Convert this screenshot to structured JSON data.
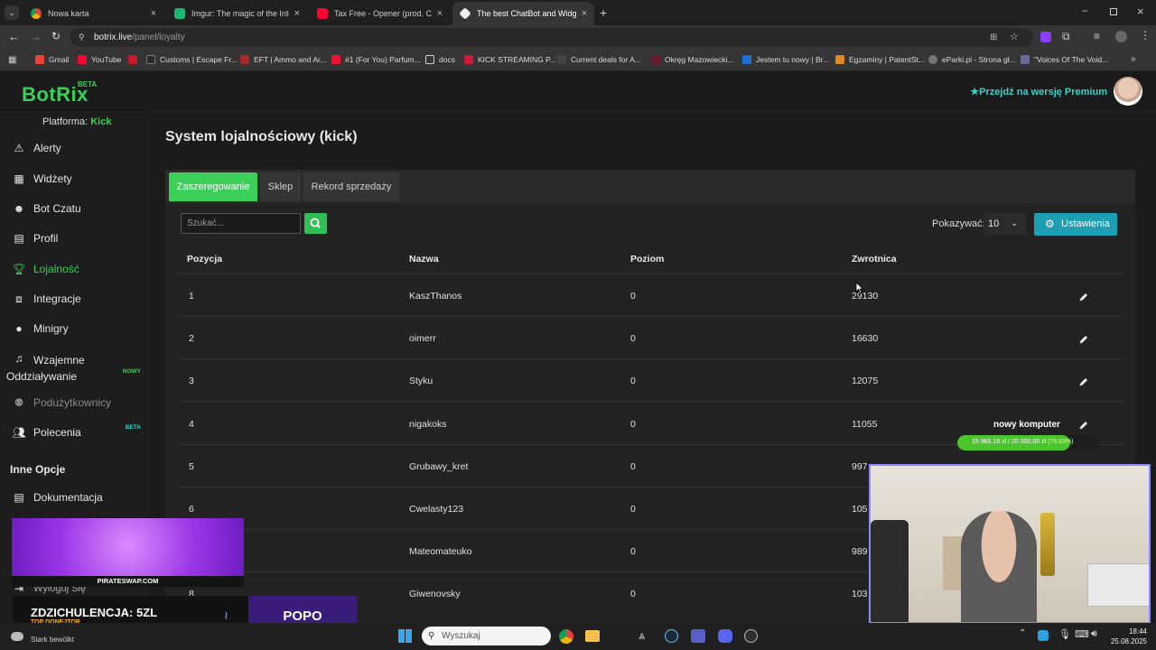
{
  "browser": {
    "tabs": [
      {
        "title": "Nowa karta",
        "icon": "chrome-icon"
      },
      {
        "title": "Imgur: The magic of the Internet",
        "icon": "imgur-icon"
      },
      {
        "title": "Tax Free - Opener (prod. CUZOMY)",
        "icon": "youtube-icon"
      },
      {
        "title": "The best ChatBot and Widgets",
        "icon": "botrix-icon"
      }
    ],
    "url_host": "botrix.live",
    "url_path": "/panel/loyalty",
    "bookmarks": [
      "Gmail",
      "YouTube",
      "Customs | Escape Fr...",
      "EFT | Ammo and Ar...",
      "#1 (For You) Parfum...",
      "docs",
      "KICK STREAMING P...",
      "Current deals for A...",
      "Okręg Mazowiecki...",
      "Jestem tu nowy | Br...",
      "Egzaminy | PatentSt...",
      "eParki.pl - Strona gł...",
      "\"Voices Of The Void..."
    ]
  },
  "header": {
    "logo": "BotRix",
    "beta": "BETA",
    "premium": "Przejdź na wersję Premium"
  },
  "sidebar": {
    "platform_label": "Platforma:",
    "platform_value": "Kick",
    "items": [
      {
        "label": "Alerty",
        "icon": "warning-icon"
      },
      {
        "label": "Widżety",
        "icon": "widgets-icon"
      },
      {
        "label": "Bot Czatu",
        "icon": "robot-icon"
      },
      {
        "label": "Profil",
        "icon": "profile-icon"
      },
      {
        "label": "Lojalność",
        "icon": "trophy-icon"
      },
      {
        "label": "Integracje",
        "icon": "integration-icon"
      },
      {
        "label": "Minigry",
        "icon": "gamepad-icon"
      },
      {
        "label": "Wzajemne Oddziaływanie",
        "icon": "music-icon",
        "badge": "NOWY"
      },
      {
        "label": "Podużytkownicy",
        "icon": "subusers-icon"
      },
      {
        "label": "Polecenia",
        "icon": "users-icon",
        "badge": "BETA"
      }
    ],
    "section_title": "Inne Opcje",
    "docs_label": "Dokumentacja",
    "logout_label": "Wyloguj Się"
  },
  "main": {
    "title": "System lojalnościowy (kick)",
    "tabs": [
      "Zaszeregowanie",
      "Sklep",
      "Rekord sprzedaży"
    ],
    "search_placeholder": "Szukać...",
    "show_label": "Pokazywać:",
    "show_value": "10",
    "settings_label": "Ustawienia",
    "columns": [
      "Pozycja",
      "Nazwa",
      "Poziom",
      "Zwrotnica"
    ],
    "rows": [
      {
        "pos": "1",
        "name": "KaszThanos",
        "level": "0",
        "points": "29130"
      },
      {
        "pos": "2",
        "name": "oimerr",
        "level": "0",
        "points": "16630"
      },
      {
        "pos": "3",
        "name": "Styku",
        "level": "0",
        "points": "12075"
      },
      {
        "pos": "4",
        "name": "nigakoks",
        "level": "0",
        "points": "11055"
      },
      {
        "pos": "5",
        "name": "Grubawy_kret",
        "level": "0",
        "points": "997"
      },
      {
        "pos": "6",
        "name": "Cwelasty123",
        "level": "0",
        "points": "105"
      },
      {
        "pos": "",
        "name": "Mateomateuko",
        "level": "0",
        "points": "989"
      },
      {
        "pos": "8",
        "name": "Giwenovsky",
        "level": "0",
        "points": "103"
      }
    ]
  },
  "overlay": {
    "goal_name": "nowy komputer",
    "goal_text": "15 965,16 zł / 20 000,00 zł",
    "goal_percent_text": "(79.83%)",
    "goal_fraction": 0.7983,
    "promo_label": "PIRATESWAP.COM",
    "donor_name": "ZDZICHULENCJA: 5ZL",
    "donor_sub": "TOP DONEJTOR",
    "donor_right": "POPO"
  },
  "taskbar": {
    "weather": "Stark bewölkt",
    "search_placeholder": "Wyszukaj",
    "time": "18:44",
    "date": "25.08.2025"
  },
  "colors": {
    "accent_green": "#3ccf5a",
    "premium_teal": "#38d2c9",
    "settings_blue": "#1d9eb2"
  }
}
